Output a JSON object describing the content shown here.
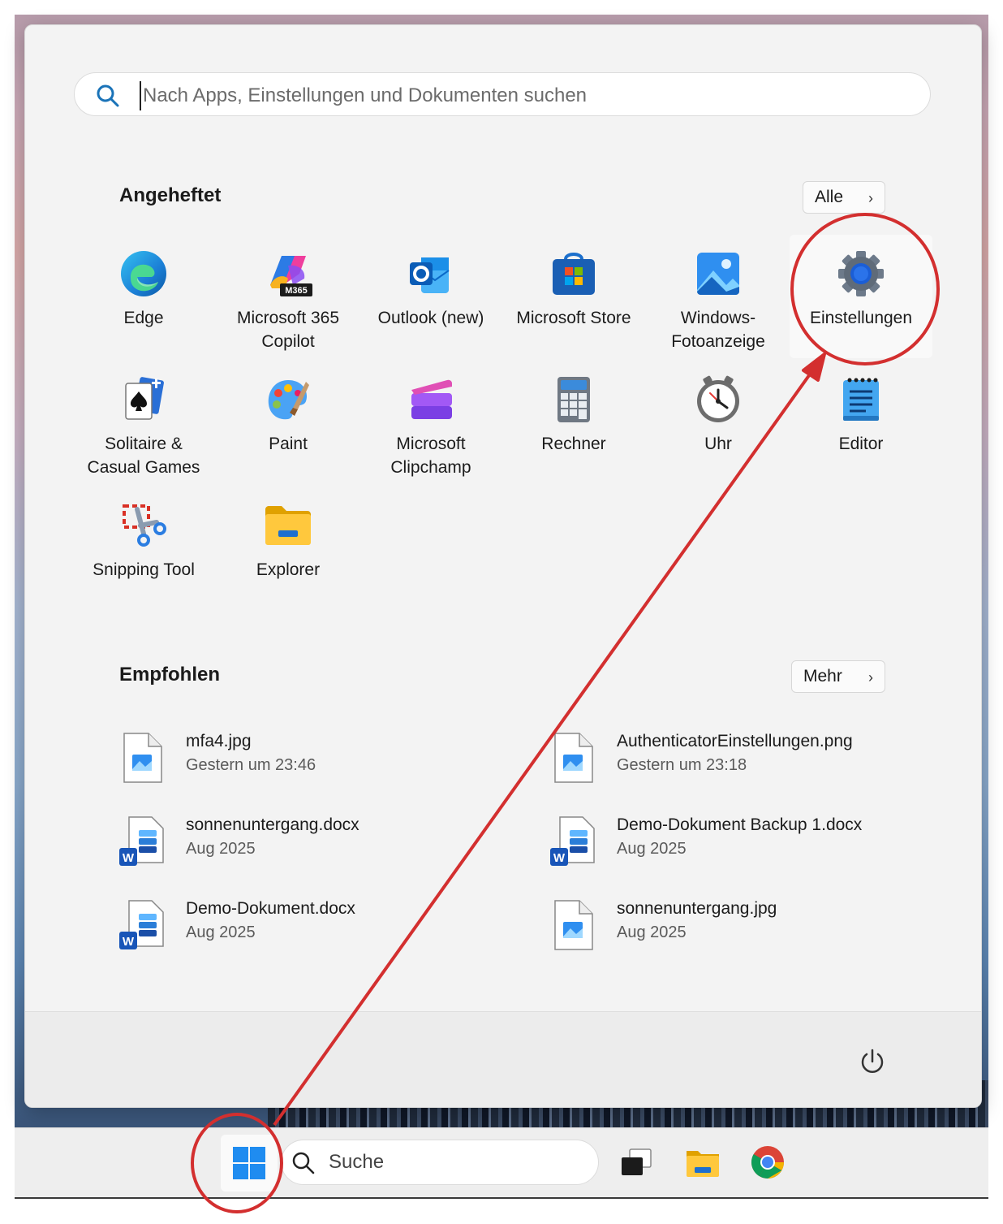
{
  "search": {
    "placeholder": "Nach Apps, Einstellungen und Dokumenten suchen"
  },
  "pinned": {
    "title": "Angeheftet",
    "all_label": "Alle",
    "apps": [
      {
        "label": "Edge",
        "icon": "edge-icon"
      },
      {
        "label": "Microsoft 365\nCopilot",
        "icon": "m365-copilot-icon",
        "badge": "M365"
      },
      {
        "label": "Outlook (new)",
        "icon": "outlook-icon"
      },
      {
        "label": "Microsoft Store",
        "icon": "store-icon"
      },
      {
        "label": "Windows-\nFotoanzeige",
        "icon": "photos-icon"
      },
      {
        "label": "Einstellungen",
        "icon": "gear-icon"
      },
      {
        "label": "Solitaire &\nCasual Games",
        "icon": "solitaire-icon"
      },
      {
        "label": "Paint",
        "icon": "paint-icon"
      },
      {
        "label": "Microsoft\nClipchamp",
        "icon": "clipchamp-icon"
      },
      {
        "label": "Rechner",
        "icon": "calculator-icon"
      },
      {
        "label": "Uhr",
        "icon": "clock-icon"
      },
      {
        "label": "Editor",
        "icon": "notepad-icon"
      },
      {
        "label": "Snipping Tool",
        "icon": "snipping-tool-icon"
      },
      {
        "label": "Explorer",
        "icon": "folder-icon"
      }
    ]
  },
  "recommended": {
    "title": "Empfohlen",
    "more_label": "Mehr",
    "items": [
      {
        "name": "mfa4.jpg",
        "time": "Gestern um 23:46",
        "icon": "image-file-icon"
      },
      {
        "name": "AuthenticatorEinstellungen.png",
        "time": "Gestern um 23:18",
        "icon": "image-file-icon"
      },
      {
        "name": "sonnenuntergang.docx",
        "time": "Aug 2025",
        "icon": "word-file-icon"
      },
      {
        "name": "Demo-Dokument Backup 1.docx",
        "time": "Aug 2025",
        "icon": "word-file-icon"
      },
      {
        "name": "Demo-Dokument.docx",
        "time": "Aug 2025",
        "icon": "word-file-icon"
      },
      {
        "name": "sonnenuntergang.jpg",
        "time": "Aug 2025",
        "icon": "image-file-icon"
      }
    ]
  },
  "taskbar": {
    "search_label": "Suche",
    "icons": [
      "windows-start-icon",
      "search-icon",
      "task-view-icon",
      "file-explorer-icon",
      "chrome-icon"
    ]
  },
  "annotation": {
    "color": "#d32f2f"
  }
}
